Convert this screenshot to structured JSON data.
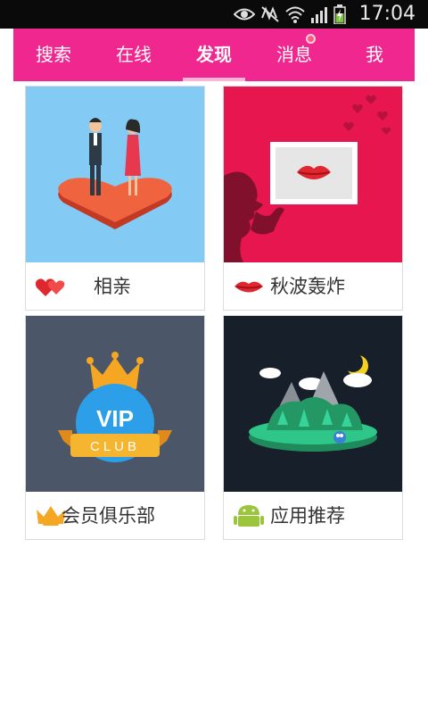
{
  "status_bar": {
    "time": "17:04",
    "icons": [
      "eye-icon",
      "mute-icon",
      "wifi-icon",
      "signal-icon",
      "battery-icon"
    ]
  },
  "tabs": [
    {
      "label": "搜索",
      "active": false
    },
    {
      "label": "在线",
      "active": false
    },
    {
      "label": "发现",
      "active": true
    },
    {
      "label": "消息",
      "active": false,
      "badge": true
    },
    {
      "label": "我",
      "active": false
    }
  ],
  "cards": [
    {
      "label": "相亲",
      "icon": "hearts-icon",
      "bg": "#83cbf4"
    },
    {
      "label": "秋波轰炸",
      "icon": "lips-icon",
      "bg": "#e8164f"
    },
    {
      "label": "会员俱乐部",
      "icon": "vip-crown-icon",
      "bg": "#4b5668"
    },
    {
      "label": "应用推荐",
      "icon": "android-icon",
      "bg": "#17202a"
    }
  ],
  "vip_badge": {
    "vip": "VIP",
    "club": "CLUB"
  },
  "colors": {
    "accent": "#f0278f",
    "status_bar": "#0a0a0a"
  }
}
